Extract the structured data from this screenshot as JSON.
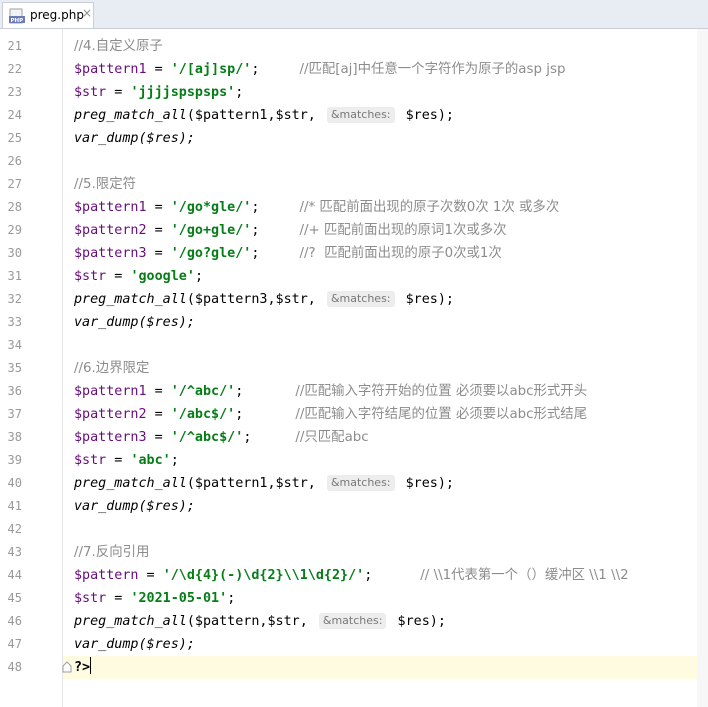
{
  "tab": {
    "label": "preg.php",
    "icon": "php-file-icon",
    "close": "×"
  },
  "colors": {
    "variable": "#660e7a",
    "string": "#067d17",
    "comment": "#8c8c8c",
    "currentLine": "#fffbe1"
  },
  "gutter": [
    21,
    22,
    23,
    24,
    25,
    26,
    27,
    28,
    29,
    30,
    31,
    32,
    33,
    34,
    35,
    36,
    37,
    38,
    39,
    40,
    41,
    42,
    43,
    44,
    45,
    46,
    47,
    48
  ],
  "code": {
    "l21": "//4.自定义原子",
    "l22_var": "$pattern1",
    "l22_eq": " = ",
    "l22_str": "'/[aj]sp/'",
    "l22_semi": ";",
    "l22_cmt": "//匹配[aj]中任意一个字符作为原子的asp jsp",
    "l23_var": "$str",
    "l23_eq": " = ",
    "l23_str": "'jjjjspspsps'",
    "l23_semi": ";",
    "l24_fn": "preg_match_all",
    "l24_args1": "($pattern1,$str, ",
    "l24_hint": "&matches:",
    "l24_args2": " $res);",
    "l25": "var_dump($res);",
    "l27": "//5.限定符",
    "l28_var": "$pattern1",
    "l28_str": "'/go*gle/'",
    "l28_cmt": "//* 匹配前面出现的原子次数0次 1次 或多次",
    "l29_var": "$pattern2",
    "l29_str": "'/go+gle/'",
    "l29_cmt": "//+ 匹配前面出现的原词1次或多次",
    "l30_var": "$pattern3",
    "l30_str": "'/go?gle/'",
    "l30_cmt": "//?  匹配前面出现的原子0次或1次",
    "l31_var": "$str",
    "l31_str": "'google'",
    "l32_fn": "preg_match_all",
    "l32_args1": "($pattern3,$str, ",
    "l32_hint": "&matches:",
    "l32_args2": " $res);",
    "l33": "var_dump($res);",
    "l35": "//6.边界限定",
    "l36_var": "$pattern1",
    "l36_str": "'/^abc/'",
    "l36_cmt": "//匹配输入字符开始的位置 必须要以abc形式开头",
    "l37_var": "$pattern2",
    "l37_str": "'/abc$/'",
    "l37_cmt": "//匹配输入字符结尾的位置 必须要以abc形式结尾",
    "l38_var": "$pattern3",
    "l38_str": "'/^abc$/'",
    "l38_cmt": "//只匹配abc",
    "l39_var": "$str",
    "l39_str": "'abc'",
    "l40_fn": "preg_match_all",
    "l40_args1": "($pattern1,$str, ",
    "l40_hint": "&matches:",
    "l40_args2": " $res);",
    "l41": "var_dump($res);",
    "l43": "//7.反向引用",
    "l44_var": "$pattern",
    "l44_str": "'/\\d{4}(-)\\d{2}\\\\1\\d{2}/'",
    "l44_cmt": "// \\\\1代表第一个（）缓冲区 \\\\1 \\\\2",
    "l45_var": "$str",
    "l45_str": "'2021-05-01'",
    "l46_fn": "preg_match_all",
    "l46_args1": "($pattern,$str, ",
    "l46_hint": "&matches:",
    "l46_args2": " $res);",
    "l47": "var_dump($res);",
    "l48": "?>"
  }
}
